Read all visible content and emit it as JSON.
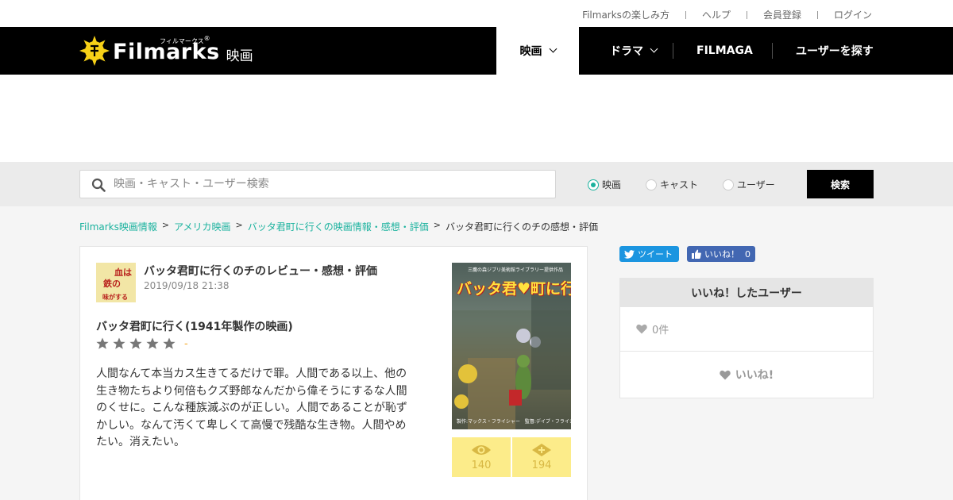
{
  "topbar": {
    "links": [
      "Filmarksの楽しみ方",
      "ヘルプ",
      "会員登録",
      "ログイン"
    ]
  },
  "header": {
    "logo_text": "Filmarks",
    "logo_kana": "フィルマークス",
    "logo_registered": "®",
    "logo_section": "映画",
    "nav": {
      "movie": "映画",
      "drama": "ドラマ",
      "filmaga": "FILMAGA",
      "find_users": "ユーザーを探す"
    }
  },
  "search": {
    "placeholder": "映画・キャスト・ユーザー検索",
    "options": [
      {
        "label": "映画",
        "selected": true
      },
      {
        "label": "キャスト",
        "selected": false
      },
      {
        "label": "ユーザー",
        "selected": false
      }
    ],
    "button": "検索"
  },
  "breadcrumb": {
    "items": [
      "Filmarks映画情報",
      "アメリカ映画",
      "バッタ君町に行くの映画情報・感想・評価"
    ],
    "separator": ">",
    "current": "バッタ君町に行くのチの感想・評価"
  },
  "review": {
    "title": "バッタ君町に行くのチのレビュー・感想・評価",
    "date": "2019/09/18 21:38",
    "avatar_text": [
      "血は",
      "鉄の",
      "味がする"
    ],
    "movie_title": "バッタ君町に行く(1941年製作の映画)",
    "rating": 0,
    "score_text": "-",
    "body": "人間なんて本当カス生きてるだけで罪。人間である以上、他の生き物たちより何倍もクズ野郎なんだから偉そうにするな人間のくせに。こんな種族滅ぶのが正しい。人間であることが恥ずかしい。なんて汚くて卑しくて高慢で残酷な生き物。人間やめたい。消えたい。",
    "poster": {
      "title": "バッタ君♥町に行く",
      "top_text": "三鷹の森ジブリ美術館ライブラリー提供作品",
      "bottom_text": "製作:マックス・フライシャー　監督:デイブ・フライシャー"
    },
    "counts": {
      "watched": "140",
      "clipped": "194"
    }
  },
  "sidebar": {
    "tweet": "ツイート",
    "fb_like": "いいね！",
    "fb_count": "0",
    "likes_header": "いいね！したユーザー",
    "likes_count": "0件",
    "like_button": "いいね!"
  },
  "colors": {
    "accent": "#1bb29e",
    "header_bg": "#000000",
    "count_bg": "#fcec8a",
    "star_gray": "#777777",
    "score_orange": "#f5a623"
  }
}
